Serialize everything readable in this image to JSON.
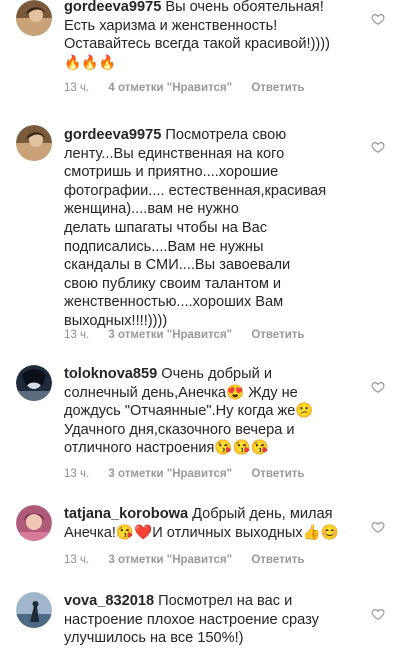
{
  "comments": [
    {
      "username": "gordeeva9975",
      "text": "Вы очень обоятельная!\nЕсть харизма и женственность!\nОставайтесь всегда такой красивой!))))",
      "emoji": "🔥🔥🔥",
      "time": "13 ч.",
      "likes": "4 отметки \"Нравится\"",
      "reply": "Ответить"
    },
    {
      "username": "gordeeva9975",
      "text": "Посмотрела свою\nленту...Вы единственная на кого\nсмотришь и приятно....хорошие\nфотографии.... естественная,красивая\nженщина)....вам не нужно\nделать шпагаты чтобы на Вас\nподписались....Вам не нужны\nскандалы в СМИ....Вы завоевали\nсвою публику своим талантом и\nженственностью....хороших Вам\nвыходных!!!!))))",
      "time": "13 ч.",
      "likes": "3 отметки \"Нравится\"",
      "reply": "Ответить"
    },
    {
      "username": "toloknova859",
      "text": "Очень добрый и\nсолнечный день,Анечка😍 Жду не\nдождусь \"Отчаянные\".Ну когда же😕\nУдачного дня,сказочного вечера и\nотличного настроения😘😘😘",
      "time": "13 ч.",
      "likes": "3 отметки \"Нравится\"",
      "reply": "Ответить"
    },
    {
      "username": "tatjana_korobowa",
      "text": "Добрый день, милая\nАнечка!😘❤️И отличных выходных👍😊",
      "time": "13 ч.",
      "likes": "3 отметки \"Нравится\"",
      "reply": "Ответить"
    },
    {
      "username": "vova_832018",
      "text": "Посмотрел на вас и\nнастроение плохое настроение сразу\nулучшилось на все 150%!)"
    }
  ],
  "colors": {
    "text": "#262626",
    "meta": "#8e8e8e",
    "heart_stroke": "#999999"
  },
  "icons": {
    "like": "heart-outline-icon"
  }
}
